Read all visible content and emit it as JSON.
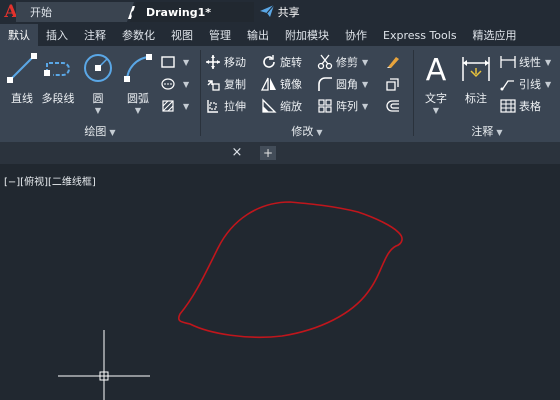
{
  "qat": {
    "app_logo": "A",
    "share_label": "共享",
    "icons": [
      "new-icon",
      "open-icon",
      "save-icon",
      "save-as-icon",
      "plot-preview-icon",
      "open-web-icon",
      "print-icon",
      "undo-icon",
      "redo-icon",
      "share-icon"
    ]
  },
  "ribbon_tabs": [
    "默认",
    "插入",
    "注释",
    "参数化",
    "视图",
    "管理",
    "输出",
    "附加模块",
    "协作",
    "Express Tools",
    "精选应用"
  ],
  "active_tab": "默认",
  "panels": {
    "draw": {
      "title": "绘图",
      "line": "直线",
      "polyline": "多段线",
      "circle": "圆",
      "arc": "圆弧"
    },
    "modify": {
      "title": "修改",
      "move": "移动",
      "rotate": "旋转",
      "trim": "修剪",
      "copy": "复制",
      "mirror": "镜像",
      "fillet": "圆角",
      "stretch": "拉伸",
      "scale": "缩放",
      "array": "阵列"
    },
    "annotation": {
      "title": "注释",
      "text": "文字",
      "dimension": "标注",
      "linear": "线性",
      "leader": "引线",
      "table": "表格"
    }
  },
  "doc_tabs": {
    "start": "开始",
    "drawing": "Drawing1*",
    "close": "×",
    "add": "+"
  },
  "viewport": {
    "label": "[−][俯视][二维线框]",
    "curve_color": "#c0161c",
    "crosshair_color": "#ffffff"
  },
  "colors": {
    "ribbon_bg": "#3a4553",
    "canvas_bg": "#212830",
    "accent_blue": "#5aa7e6"
  }
}
